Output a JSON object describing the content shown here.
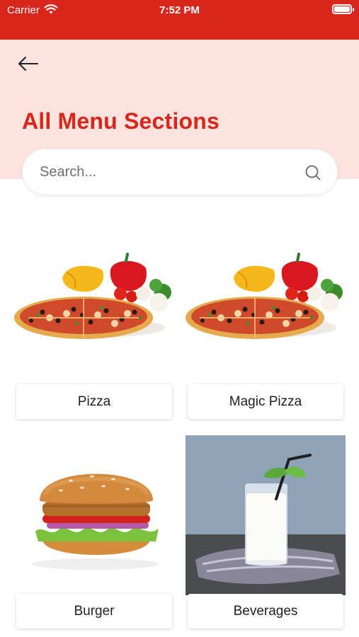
{
  "status_bar": {
    "carrier": "Carrier",
    "time": "7:52 PM"
  },
  "header": {
    "back_icon": "arrow-left-icon",
    "title": "All Menu Sections"
  },
  "search": {
    "placeholder": "Search...",
    "icon": "search-icon"
  },
  "sections": [
    {
      "label": "Pizza"
    },
    {
      "label": "Magic Pizza"
    },
    {
      "label": "Burger"
    },
    {
      "label": "Beverages"
    }
  ],
  "colors": {
    "brand_red": "#d9261c",
    "hero_background": "#fde3de"
  }
}
